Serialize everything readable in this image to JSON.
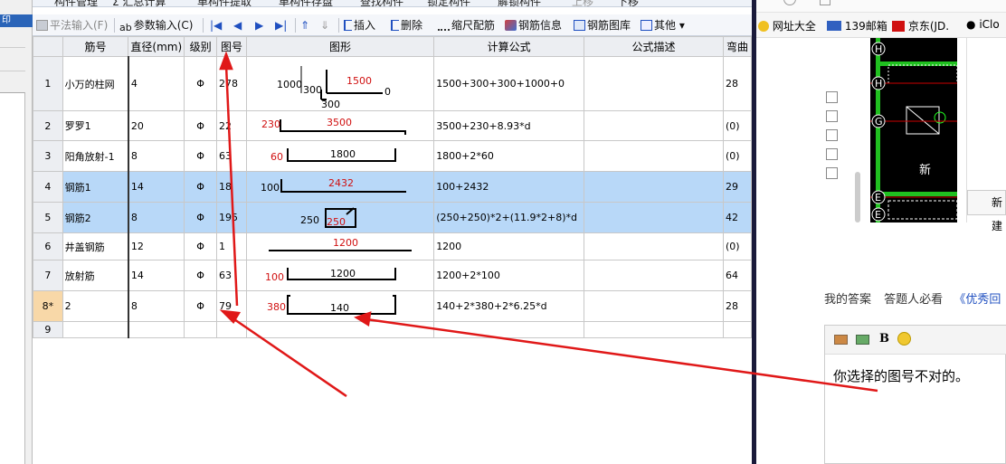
{
  "left_panel": {
    "header": "印"
  },
  "top_toolbar": {
    "items": [
      "构件管理",
      "Σ 汇总计算",
      "单构件提取",
      "单构件存盘",
      "查找构件",
      "锁定构件",
      "解锁构件",
      "上移",
      "下移"
    ]
  },
  "toolbar": {
    "flat_input": "平法输入(F)",
    "param_input": "参数输入(C)",
    "insert": "插入",
    "delete": "删除",
    "scale_rebar": "缩尺配筋",
    "rebar_info": "钢筋信息",
    "rebar_library": "钢筋图库",
    "other": "其他"
  },
  "table": {
    "headers": [
      "筋号",
      "直径(mm)",
      "级别",
      "图号",
      "图形",
      "计算公式",
      "公式描述",
      "弯曲"
    ],
    "rows": [
      {
        "num": "1",
        "name": "小万的柱网",
        "dia": "4",
        "grade": "Φ",
        "fig": "278",
        "formula": "1500+300+300+1000+0",
        "desc": "",
        "bend": "28",
        "shape_labels": [
          "1000",
          "300",
          "1500",
          "0",
          "300"
        ]
      },
      {
        "num": "2",
        "name": "罗罗1",
        "dia": "20",
        "grade": "Φ",
        "fig": "22",
        "formula": "3500+230+8.93*d",
        "desc": "",
        "bend": "(0)",
        "shape_labels": [
          "230",
          "3500"
        ]
      },
      {
        "num": "3",
        "name": "阳角放射-1",
        "dia": "8",
        "grade": "Φ",
        "fig": "63",
        "formula": "1800+2*60",
        "desc": "",
        "bend": "(0)",
        "shape_labels": [
          "60",
          "1800"
        ]
      },
      {
        "num": "4",
        "name": "钢筋1",
        "dia": "14",
        "grade": "Φ",
        "fig": "18",
        "formula": "100+2432",
        "desc": "",
        "bend": "29",
        "shape_labels": [
          "100",
          "2432"
        ]
      },
      {
        "num": "5",
        "name": "钢筋2",
        "dia": "8",
        "grade": "Φ",
        "fig": "195",
        "formula": "(250+250)*2+(11.9*2+8)*d",
        "desc": "",
        "bend": "42",
        "shape_labels": [
          "250",
          "250"
        ]
      },
      {
        "num": "6",
        "name": "井盖钢筋",
        "dia": "12",
        "grade": "Φ",
        "fig": "1",
        "formula": "1200",
        "desc": "",
        "bend": "(0)",
        "shape_labels": [
          "1200"
        ]
      },
      {
        "num": "7",
        "name": "放射筋",
        "dia": "14",
        "grade": "Φ",
        "fig": "63",
        "formula": "1200+2*100",
        "desc": "",
        "bend": "64",
        "shape_labels": [
          "100",
          "1200"
        ]
      },
      {
        "num": "8*",
        "name": "2",
        "dia": "8",
        "grade": "Φ",
        "fig": "79",
        "formula": "140+2*380+2*6.25*d",
        "desc": "",
        "bend": "28",
        "shape_labels": [
          "380",
          "140"
        ]
      },
      {
        "num": "9",
        "name": "",
        "dia": "",
        "grade": "",
        "fig": "",
        "formula": "",
        "desc": "",
        "bend": "",
        "shape_labels": []
      }
    ]
  },
  "browser": {
    "bookmarks": [
      "网址大全",
      "139邮箱",
      "京东(JD.",
      "iClo"
    ],
    "tabs_label": "我的答案",
    "tabs_label2": "答题人必看",
    "tabs_label3": "《优秀回",
    "answer_text": "你选择的图号不对的。",
    "new_button": "新建",
    "axis_labels": [
      "H",
      "H",
      "G",
      "E",
      "E"
    ],
    "drawing_text": "新"
  },
  "colors": {
    "selected_row": "#b8d8f8",
    "active_row_header": "#f8d8a8",
    "arrow": "#e01818",
    "dim_red": "#d01010"
  }
}
